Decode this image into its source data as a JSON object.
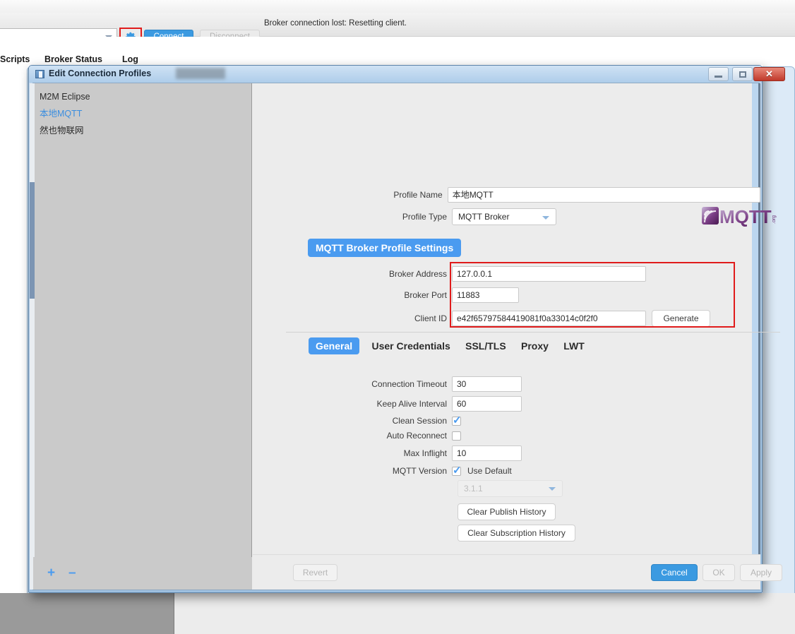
{
  "toolbar": {
    "broker_combo_value": "",
    "gear_icon": "gear-icon",
    "connect_label": "Connect",
    "disconnect_label": "Disconnect",
    "status_message": "Broker connection lost: Resetting client."
  },
  "main_tabs": [
    {
      "label": "Scripts"
    },
    {
      "label": "Broker Status"
    },
    {
      "label": "Log"
    }
  ],
  "dialog": {
    "title": "Edit Connection Profiles",
    "window_buttons": {
      "minimize": "minimize-icon",
      "maximize": "maximize-icon",
      "close": "✕"
    },
    "sidebar": {
      "items": [
        {
          "label": "M2M Eclipse",
          "selected": false
        },
        {
          "label": "本地MQTT",
          "selected": true
        },
        {
          "label": "然也物联网",
          "selected": false
        }
      ],
      "add_label": "+",
      "remove_label": "–"
    },
    "profile": {
      "name_label": "Profile Name",
      "name_value": "本地MQTT",
      "type_label": "Profile Type",
      "type_value": "MQTT Broker",
      "type_options": [
        "MQTT Broker"
      ],
      "logo_text": "MQTT",
      "logo_sub": ".org"
    },
    "section_title": "MQTT Broker Profile Settings",
    "broker": {
      "address_label": "Broker Address",
      "address_value": "127.0.0.1",
      "port_label": "Broker Port",
      "port_value": "11883",
      "client_id_label": "Client ID",
      "client_id_value": "e42f65797584419081f0a33014c0f2f0",
      "generate_label": "Generate"
    },
    "tabs": [
      {
        "label": "General",
        "active": true
      },
      {
        "label": "User Credentials",
        "active": false
      },
      {
        "label": "SSL/TLS",
        "active": false
      },
      {
        "label": "Proxy",
        "active": false
      },
      {
        "label": "LWT",
        "active": false
      }
    ],
    "general": {
      "connection_timeout_label": "Connection Timeout",
      "connection_timeout_value": "30",
      "keep_alive_label": "Keep Alive Interval",
      "keep_alive_value": "60",
      "clean_session_label": "Clean Session",
      "clean_session_checked": true,
      "auto_reconnect_label": "Auto Reconnect",
      "auto_reconnect_checked": false,
      "max_inflight_label": "Max Inflight",
      "max_inflight_value": "10",
      "mqtt_version_label": "MQTT Version",
      "use_default_label": "Use Default",
      "use_default_checked": true,
      "version_value": "3.1.1",
      "version_options": [
        "3.1.1"
      ],
      "clear_publish_label": "Clear Publish History",
      "clear_subscription_label": "Clear Subscription History"
    },
    "footer": {
      "revert_label": "Revert",
      "cancel_label": "Cancel",
      "ok_label": "OK",
      "apply_label": "Apply"
    }
  },
  "colors": {
    "accent_blue": "#4a9bf0",
    "connect_blue": "#3b9ae1",
    "highlight_red": "#e01b1b",
    "dialog_bg": "#ececec",
    "sidebar_bg": "#cacaca"
  }
}
